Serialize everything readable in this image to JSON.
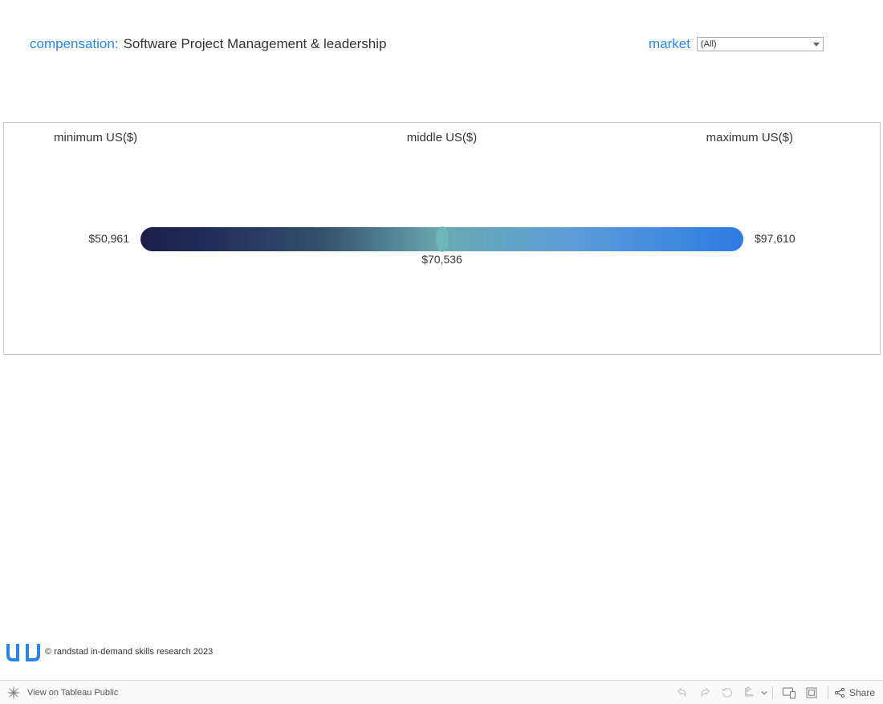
{
  "header": {
    "title_prefix": "compensation:",
    "title_value": "Software Project Management & leadership",
    "filter_label": "market",
    "filter_selected": "(All)"
  },
  "columns": {
    "min": "minimum US($)",
    "mid": "middle US($)",
    "max": "maximum US($)"
  },
  "values": {
    "min_label": "$50,961",
    "mid_label": "$70,536",
    "max_label": "$97,610"
  },
  "attribution": {
    "text": "© randstad in-demand skills research 2023"
  },
  "toolbar": {
    "view_link": "View on Tableau Public",
    "share": "Share"
  },
  "chart_data": {
    "type": "bar",
    "title": "compensation: Software Project Management & leadership",
    "categories": [
      "minimum US($)",
      "middle US($)",
      "maximum US($)"
    ],
    "values": [
      50961,
      70536,
      97610
    ],
    "xlabel": "",
    "ylabel": "US($)",
    "ylim": [
      50961,
      97610
    ]
  }
}
